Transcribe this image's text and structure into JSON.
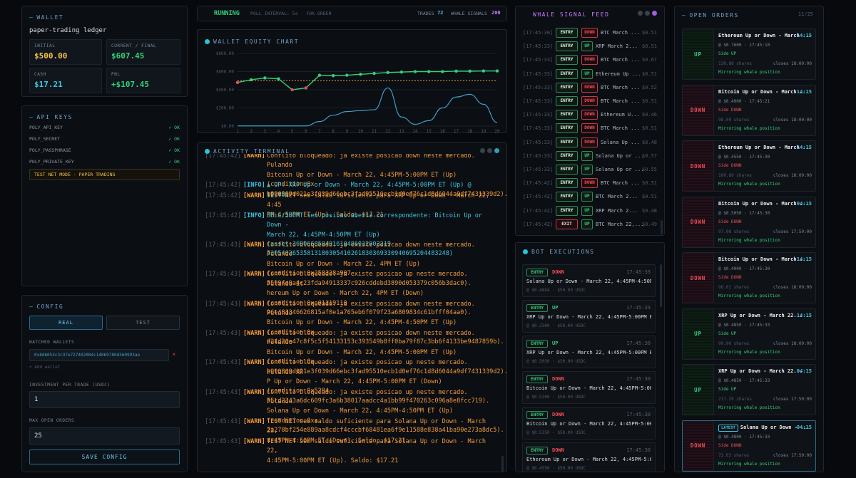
{
  "wallet": {
    "title": "WALLET",
    "subtitle": "paper-trading ledger",
    "initial_label": "INITIAL",
    "initial_value": "$500.00",
    "current_label": "CURRENT / FINAL",
    "current_value": "$607.45",
    "cash_label": "CASH",
    "cash_value": "$17.21",
    "pnl_label": "PNL",
    "pnl_value": "+$107.45"
  },
  "api": {
    "title": "API KEYS",
    "keys": [
      {
        "name": "POLY_API_KEY",
        "status": "✓ OK"
      },
      {
        "name": "POLY_SECRET",
        "status": "✓ OK"
      },
      {
        "name": "POLY_PASSPHRASE",
        "status": "✓ OK"
      },
      {
        "name": "POLY_PRIVATE_KEY",
        "status": "✓ OK"
      }
    ],
    "mode_banner": "TEST NET MODE - PAPER TRADING"
  },
  "config": {
    "title": "CONFIG",
    "real_label": "REAL",
    "test_label": "TEST",
    "watched_label": "WATCHED WALLETS",
    "wallet_value": "0x8d6053c3c37e727402084c14069780d360993ae",
    "add_wallet": "+ Add wallet",
    "investment_label": "INVESTMENT PER TRADE (USDC)",
    "investment_value": "1",
    "max_orders_label": "MAX OPEN ORDERS",
    "max_orders_value": "25",
    "save_label": "SAVE CONFIG"
  },
  "status": {
    "running": "RUNNING",
    "poll": "POLL INTERVAL: 5s · FOK ORDER",
    "trades_label": "TRADES",
    "trades_value": "72",
    "whale_label": "WHALE SIGNALS",
    "whale_value": "200"
  },
  "equity": {
    "title": "WALLET EQUITY CHART"
  },
  "chart_data": {
    "type": "line",
    "title": "WALLET EQUITY CHART",
    "x": [
      1,
      2,
      3,
      4,
      5,
      6,
      7,
      8,
      9,
      10,
      11,
      12,
      13,
      14,
      15,
      16,
      17,
      18,
      19,
      20
    ],
    "ylim": [
      0,
      800
    ],
    "yticks": [
      "$0.00",
      "$200.00",
      "$400.00",
      "$600.00",
      "$800.00"
    ],
    "baseline": 500,
    "series": [
      {
        "values": [
          480,
          510,
          530,
          520,
          400,
          420,
          560,
          555,
          560,
          570,
          580,
          590,
          595,
          600,
          600,
          600,
          605,
          605,
          607,
          607
        ],
        "color": "#33d17a"
      },
      {
        "values": [
          2,
          2,
          2,
          2,
          2,
          2,
          50,
          120,
          160,
          170,
          180,
          420,
          100,
          20,
          60,
          200,
          320,
          350,
          240,
          40
        ],
        "color": "#3fa0c8"
      }
    ]
  },
  "activity": {
    "title": "ACTIVITY TERMINAL",
    "lines": [
      {
        "ts": "[17:45:42]",
        "tag": "[WARN]",
        "level": "warn",
        "msg": "Conflito bloqueado: ja existe posicao down neste mercado. Pulando\nBitcoin Up or Down - March 22, 4:45PM-5:00PM ET (Up) (condition:0x\nb990809d021e3f039d66ebc3fad95510ecb1d0ef76c1d8d6044a9df7431339d2)."
      },
      {
        "ts": "[17:45:42]",
        "tag": "[INFO]",
        "level": "info",
        "msg": "▲ UP: XRP Up or Down - March 22, 4:45PM-5:00PM ET (Up) @ $0.485"
      },
      {
        "ts": "[17:45:42]",
        "tag": "[WARN]",
        "level": "warn",
        "msg": "TEST NET sem saldo suficiente para XRP Up or Down - March 22, 4:45\nPM-4:50PM ET (Up). Saldo: $17.21"
      },
      {
        "ts": "[17:45:42]",
        "tag": "[INFO]",
        "level": "info",
        "msg": "SELL/SHORT sem posicao aberta correspondente: Bitcoin Up or Down -\nMarch 22, 4:45PM-4:50PM ET (Up) (asset:369066850491610486032902219\n53054026535813180305410261830369330940695204483248)"
      },
      {
        "ts": "[17:45:43]",
        "tag": "[WARN]",
        "level": "warn",
        "msg": "Conflito bloqueado: ja existe posicao down neste mercado. Pulando\nBitcoin Up or Down - March 22, 4PM ET (Up) (condition:0x258328a907\n5599fe9a4c23fda94913337c926cddebd3890d053379c056b3dac0)."
      },
      {
        "ts": "[17:45:43]",
        "tag": "[WARN]",
        "level": "warn",
        "msg": "Conflito bloqueado: ja existe posicao up neste mercado. Pulando Et\nhereum Up or Down - March 22, 4PM ET (Down) (condition:0xa01119110\n96e481346626815af0e1a765eb6f079f23a6809834c61bfff04aa0)."
      },
      {
        "ts": "[17:45:43]",
        "tag": "[WARN]",
        "level": "warn",
        "msg": "Conflito bloqueado: ja existe posicao down neste mercado. Pulando\nBitcoin Up or Down - March 22, 4:45PM-4:50PM ET (Up) (condition:0x\nd24d20e47c8f5c5f54133153c393549b8ff0ba79f87c3bb6f4133be9487859b)."
      },
      {
        "ts": "[17:45:43]",
        "tag": "[WARN]",
        "level": "warn",
        "msg": "Conflito bloqueado: ja existe posicao down neste mercado. Pulando\nBitcoin Up or Down - March 22, 4:45PM-5:00PM ET (Up) (condition:0x\nb990809d021e3f039d66ebc3fad95510ecb1d0ef76c1d8d6044a9df7431339d2)."
      },
      {
        "ts": "[17:45:43]",
        "tag": "[WARN]",
        "level": "warn",
        "msg": "Conflito bloqueado: ja existe posicao up neste mercado. Pulando XR\nP Up or Down - March 22, 4:45PM-5:00PM ET (Down) (condition:0x5284\n55cd2343a6dc609fc3a6b38017aadcc4a1bb99f470263c096a8e8fcc719)."
      },
      {
        "ts": "[17:45:43]",
        "tag": "[WARN]",
        "level": "warn",
        "msg": "Conflito bloqueado: ja existe posicao up neste mercado. Pulando\nSolana Up or Down - March 22, 4:45PM-4:50PM ET (Up) (condition:0xa\n2a278bf254e889aa8cdcf4cccbf68481ea6f9e11588e838a41ba90e273a8dc5)."
      },
      {
        "ts": "[17:45:43]",
        "tag": "[WARN]",
        "level": "warn",
        "msg": "TEST NET sem saldo suficiente para Solana Up or Down - March 22,\n4:45PM-4:50PM ET (Down). Saldo: $17.21"
      },
      {
        "ts": "[17:45:43]",
        "tag": "[WARN]",
        "level": "warn",
        "msg": "TEST NET sem saldo suficiente para Solana Up or Down - March 22,\n4:45PM-5:00PM ET (Up). Saldo: $17.21"
      }
    ]
  },
  "whale": {
    "title": "WHALE SIGNAL FEED",
    "rows": [
      {
        "ts": "[17:45:30]",
        "action": "ENTRY",
        "side": "DOWN",
        "market": "BTC March ...",
        "price": "$0.51"
      },
      {
        "ts": "[17:45:33]",
        "action": "ENTRY",
        "side": "UP",
        "market": "XRP March 2...",
        "price": "$0.51"
      },
      {
        "ts": "[17:45:33]",
        "action": "ENTRY",
        "side": "DOWN",
        "market": "BTC March ...",
        "price": "$0.67"
      },
      {
        "ts": "[17:45:33]",
        "action": "ENTRY",
        "side": "UP",
        "market": "Ethereum Up ...",
        "price": "$0.51"
      },
      {
        "ts": "[17:45:33]",
        "action": "ENTRY",
        "side": "DOWN",
        "market": "BTC March ...",
        "price": "$0.52"
      },
      {
        "ts": "[17:45:33]",
        "action": "ENTRY",
        "side": "DOWN",
        "market": "BTC March ...",
        "price": "$0.51"
      },
      {
        "ts": "[17:45:33]",
        "action": "ENTRY",
        "side": "DOWN",
        "market": "Ethereum U...",
        "price": "$0.46"
      },
      {
        "ts": "[17:45:33]",
        "action": "ENTRY",
        "side": "DOWN",
        "market": "BTC March ...",
        "price": "$0.51"
      },
      {
        "ts": "[17:45:33]",
        "action": "ENTRY",
        "side": "DOWN",
        "market": "Solana Up ...",
        "price": "$0.48"
      },
      {
        "ts": "[17:45:33]",
        "action": "ENTRY",
        "side": "UP",
        "market": "Solana Up or ...",
        "price": "$0.57"
      },
      {
        "ts": "[17:45:33]",
        "action": "ENTRY",
        "side": "UP",
        "market": "Solana Up or ...",
        "price": "$0.55"
      },
      {
        "ts": "[17:45:42]",
        "action": "ENTRY",
        "side": "DOWN",
        "market": "BTC March ...",
        "price": "$0.51"
      },
      {
        "ts": "[17:45:42]",
        "action": "ENTRY",
        "side": "UP",
        "market": "BTC March 2...",
        "price": "$0.51"
      },
      {
        "ts": "[17:45:42]",
        "action": "ENTRY",
        "side": "UP",
        "market": "XRP March 2...",
        "price": "$0.48"
      },
      {
        "ts": "[17:45:42]",
        "action": "EXIT",
        "side": "UP",
        "market": "BTC March 22,...",
        "price": "$0.49"
      }
    ]
  },
  "executions": {
    "title": "BOT EXECUTIONS",
    "items": [
      {
        "action": "ENTRY",
        "side": "DOWN",
        "time": "17:45:33",
        "market": "Solana Up or Down - March 22, 4:45PM-4:50PM...",
        "sub": "@ $0.4884 · $50.00 USDC"
      },
      {
        "action": "ENTRY",
        "side": "UP",
        "time": "17:45:33",
        "market": "XRP Up or Down - March 22, 4:45PM-5:00PM ET...",
        "sub": "@ $0.2300 · $50.00 USDC"
      },
      {
        "action": "ENTRY",
        "side": "UP",
        "time": "17:45:30",
        "market": "XRP Up or Down - March 22, 4:45PM-5:00PM ET...",
        "sub": "@ $0.5050 · $50.00 USDC"
      },
      {
        "action": "ENTRY",
        "side": "DOWN",
        "time": "17:45:30",
        "market": "Bitcoin Up or Down - March 22, 4:45PM-5:00P...",
        "sub": "@ $0.5100 · $50.00 USDC"
      },
      {
        "action": "ENTRY",
        "side": "DOWN",
        "time": "17:45:30",
        "market": "Bitcoin Up or Down - March 22, 4:45PM-5:00P...",
        "sub": "@ $0.5150 · $50.00 USDC"
      },
      {
        "action": "ENTRY",
        "side": "DOWN",
        "time": "17:45:30",
        "market": "Ethereum Up or Down - March 22, 4:45PM-5:00...",
        "sub": "@ $0.4550 · $50.00 USDC"
      }
    ]
  },
  "orders": {
    "title": "OPEN ORDERS",
    "count": "11/25",
    "items": [
      {
        "side": "UP",
        "title": "Ethereum Up or Down - March ...",
        "time": "14:15",
        "price": "@ $0.7600 · 17:45:10",
        "side_text": "Side UP",
        "shares": "138.88 shares",
        "closes": "closes 18:00:00",
        "mirror": "Mirroring whale position",
        "latest": ""
      },
      {
        "side": "DOWN",
        "title": "Bitcoin Up or Down - March ...",
        "time": "14:15",
        "price": "@ $0.4900 · 17:45:21",
        "side_text": "Side DOWN",
        "shares": "98.00 shares",
        "closes": "closes 18:00:00",
        "mirror": "Mirroring whale position",
        "latest": ""
      },
      {
        "side": "DOWN",
        "title": "Ethereum Up or Down - March ...",
        "time": "14:15",
        "price": "@ $0.4550 · 17:45:30",
        "side_text": "Side DOWN",
        "shares": "109.89 shares",
        "closes": "closes 18:00:00",
        "mirror": "Mirroring whale position",
        "latest": ""
      },
      {
        "side": "DOWN",
        "title": "Bitcoin Up or Down - March ...",
        "time": "04:15",
        "price": "@ $0.5050 · 17:45:30",
        "side_text": "Side DOWN",
        "shares": "97.08 shares",
        "closes": "closes 17:50:00",
        "mirror": "Mirroring whale position",
        "latest": ""
      },
      {
        "side": "DOWN",
        "title": "Bitcoin Up or Down - March ...",
        "time": "14:15",
        "price": "@ $0.4900 · 17:45:30",
        "side_text": "Side DOWN",
        "shares": "98.01 shares",
        "closes": "closes 18:00:00",
        "mirror": "Mirroring whale position",
        "latest": ""
      },
      {
        "side": "UP",
        "title": "XRP Up or Down - March 22...",
        "time": "14:15",
        "price": "@ $0.4850 · 17:45:33",
        "side_text": "Side UP",
        "shares": "99.00 shares",
        "closes": "closes 18:00:00",
        "mirror": "Mirroring whale position",
        "latest": ""
      },
      {
        "side": "UP",
        "title": "XRP Up or Down - March 22...",
        "time": "04:15",
        "price": "@ $0.4850 · 17:45:33",
        "side_text": "Side UP",
        "shares": "217.29 shares",
        "closes": "closes 17:50:00",
        "mirror": "Mirroring whale position",
        "latest": ""
      },
      {
        "side": "DOWN",
        "title": "Solana Up or Down - ...",
        "time": "04:15",
        "price": "@ $0.4800 · 17:45:33",
        "side_text": "Side DOWN",
        "shares": "72.03 shares",
        "closes": "closes 17:50:00",
        "mirror": "Mirroring whale position",
        "latest": "LATEST"
      }
    ]
  }
}
